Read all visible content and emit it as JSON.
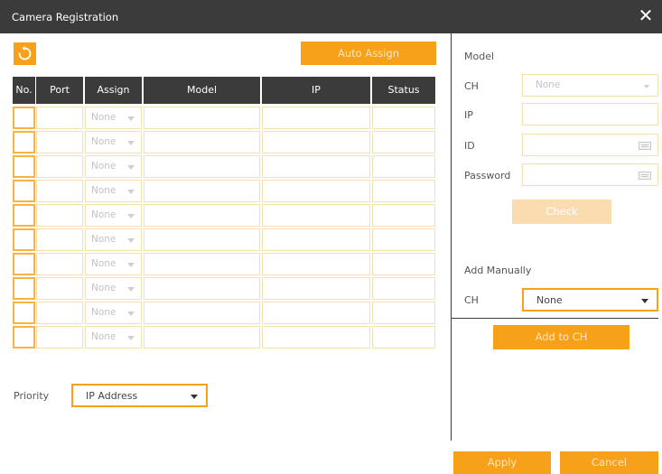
{
  "window": {
    "title": "Camera Registration",
    "close_icon": "close-icon"
  },
  "toolbar": {
    "refresh_icon": "refresh-icon",
    "auto_assign_label": "Auto Assign"
  },
  "table": {
    "headers": [
      "No.",
      "Port",
      "Assign",
      "Model",
      "IP",
      "Status"
    ],
    "rows": [
      {
        "no": "",
        "port": "",
        "assign": "None",
        "model": "",
        "ip": "",
        "status": ""
      },
      {
        "no": "",
        "port": "",
        "assign": "None",
        "model": "",
        "ip": "",
        "status": ""
      },
      {
        "no": "",
        "port": "",
        "assign": "None",
        "model": "",
        "ip": "",
        "status": ""
      },
      {
        "no": "",
        "port": "",
        "assign": "None",
        "model": "",
        "ip": "",
        "status": ""
      },
      {
        "no": "",
        "port": "",
        "assign": "None",
        "model": "",
        "ip": "",
        "status": ""
      },
      {
        "no": "",
        "port": "",
        "assign": "None",
        "model": "",
        "ip": "",
        "status": ""
      },
      {
        "no": "",
        "port": "",
        "assign": "None",
        "model": "",
        "ip": "",
        "status": ""
      },
      {
        "no": "",
        "port": "",
        "assign": "None",
        "model": "",
        "ip": "",
        "status": ""
      },
      {
        "no": "",
        "port": "",
        "assign": "None",
        "model": "",
        "ip": "",
        "status": ""
      },
      {
        "no": "",
        "port": "",
        "assign": "None",
        "model": "",
        "ip": "",
        "status": ""
      }
    ]
  },
  "priority": {
    "label": "Priority",
    "value": "IP Address"
  },
  "model_panel": {
    "heading": "Model",
    "ch_label": "CH",
    "ch_value": "None",
    "ip_label": "IP",
    "ip_value": "",
    "id_label": "ID",
    "id_value": "",
    "password_label": "Password",
    "password_value": "",
    "check_label": "Check"
  },
  "add_manually": {
    "heading": "Add Manually",
    "ch_label": "CH",
    "ch_value": "None",
    "add_label": "Add to CH"
  },
  "footer": {
    "apply_label": "Apply",
    "cancel_label": "Cancel"
  },
  "colors": {
    "accent": "#f7a11a",
    "header_bg": "#3b3b3b",
    "cell_border": "#f9dfb0",
    "disabled_button": "#fbdbb0"
  }
}
